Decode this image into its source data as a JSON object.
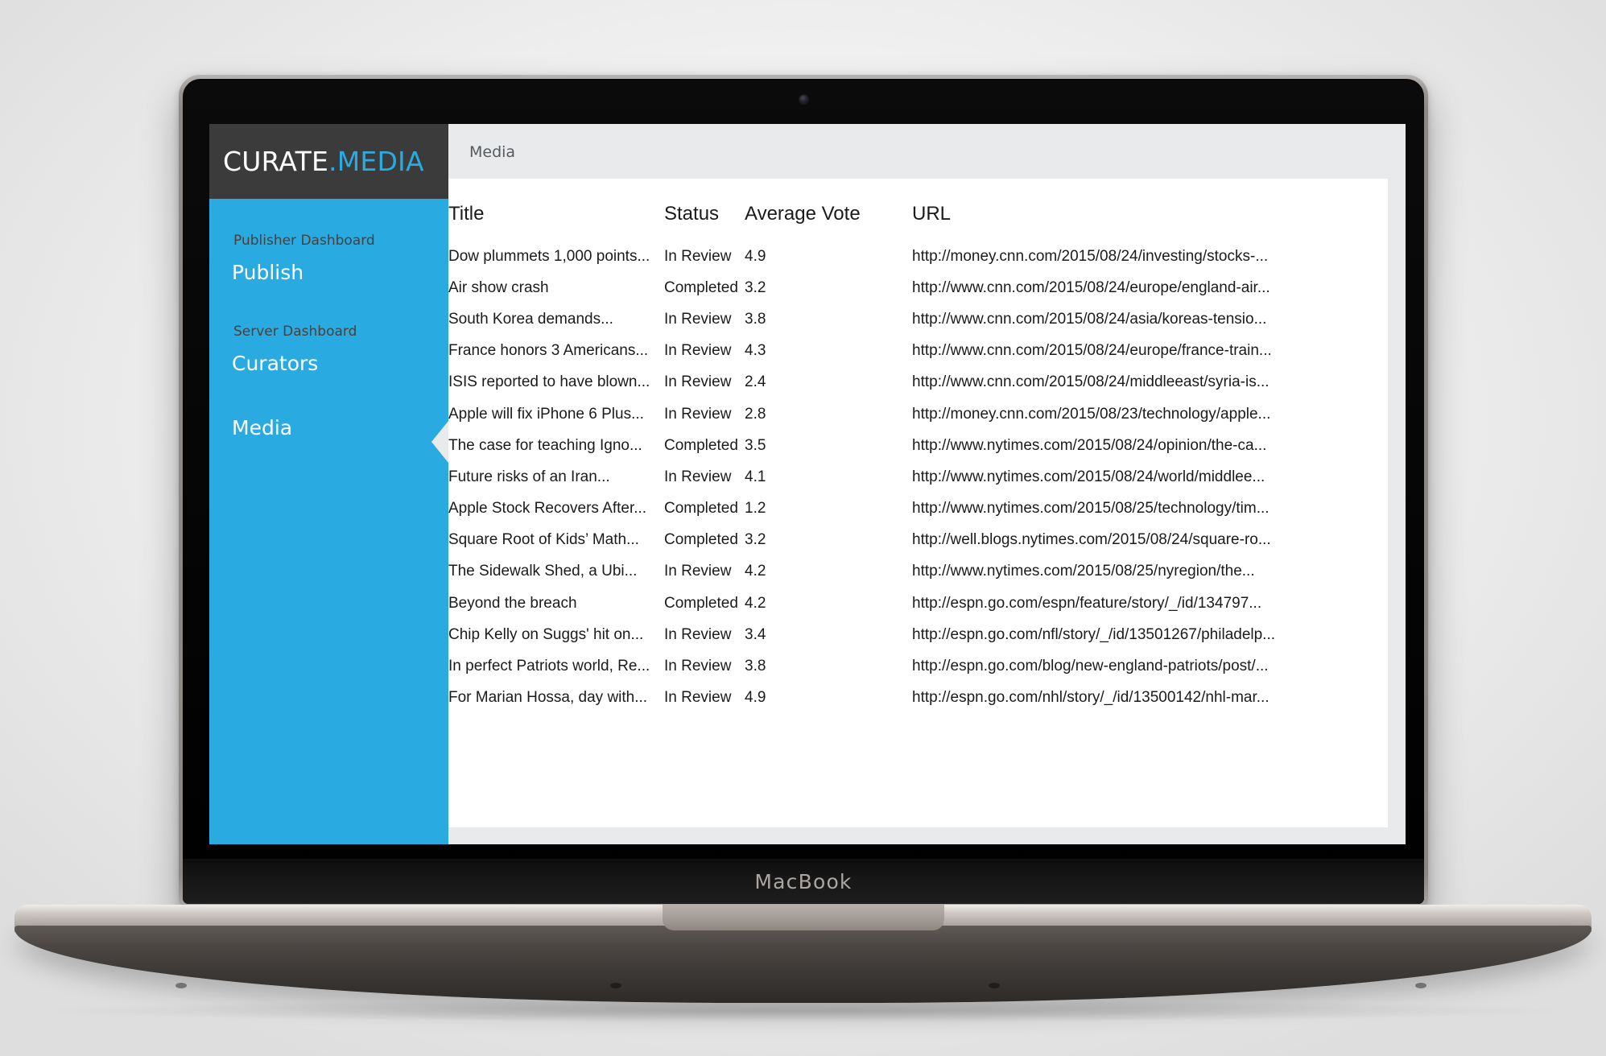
{
  "device": {
    "wordmark": "MacBook"
  },
  "brand": {
    "name": "CURATE",
    "dot": ".",
    "suffix": "MEDIA"
  },
  "sidebar": {
    "sections": [
      {
        "label": "Publisher Dashboard",
        "item": "Publish"
      },
      {
        "label": "Server Dashboard",
        "item": "Curators"
      }
    ],
    "active_item": "Media"
  },
  "content": {
    "breadcrumb": "Media"
  },
  "colors": {
    "accent": "#29ABE2",
    "brand_bar": "#3B3B3B",
    "page_bg": "#E9EAEC",
    "card_bg": "#FFFFFF",
    "text": "#1B1B1B",
    "muted_text": "#4B3F3A"
  },
  "table": {
    "columns": [
      "Title",
      "Status",
      "Average Vote",
      "URL"
    ],
    "rows": [
      {
        "title": "Dow plummets 1,000 points...",
        "status": "In Review",
        "vote": "4.9",
        "url": "http://money.cnn.com/2015/08/24/investing/stocks-..."
      },
      {
        "title": "Air show crash",
        "status": "Completed",
        "vote": "3.2",
        "url": "http://www.cnn.com/2015/08/24/europe/england-air..."
      },
      {
        "title": "South Korea demands...",
        "status": "In Review",
        "vote": "3.8",
        "url": "http://www.cnn.com/2015/08/24/asia/koreas-tensio..."
      },
      {
        "title": "France honors 3 Americans...",
        "status": "In Review",
        "vote": "4.3",
        "url": "http://www.cnn.com/2015/08/24/europe/france-train..."
      },
      {
        "title": "ISIS reported to have blown...",
        "status": "In Review",
        "vote": "2.4",
        "url": "http://www.cnn.com/2015/08/24/middleeast/syria-is..."
      },
      {
        "title": "Apple will fix iPhone 6 Plus...",
        "status": "In Review",
        "vote": "2.8",
        "url": "http://money.cnn.com/2015/08/23/technology/apple..."
      },
      {
        "title": "The case for teaching Igno...",
        "status": "Completed",
        "vote": "3.5",
        "url": "http://www.nytimes.com/2015/08/24/opinion/the-ca..."
      },
      {
        "title": "Future risks of an Iran...",
        "status": "In Review",
        "vote": "4.1",
        "url": "http://www.nytimes.com/2015/08/24/world/middlee..."
      },
      {
        "title": "Apple Stock Recovers After...",
        "status": "Completed",
        "vote": "1.2",
        "url": "http://www.nytimes.com/2015/08/25/technology/tim..."
      },
      {
        "title": "Square Root of Kids’ Math...",
        "status": "Completed",
        "vote": "3.2",
        "url": "http://well.blogs.nytimes.com/2015/08/24/square-ro..."
      },
      {
        "title": "The Sidewalk Shed, a Ubi...",
        "status": "In Review",
        "vote": "4.2",
        "url": "http://www.nytimes.com/2015/08/25/nyregion/the..."
      },
      {
        "title": "Beyond the breach",
        "status": "Completed",
        "vote": "4.2",
        "url": "http://espn.go.com/espn/feature/story/_/id/134797..."
      },
      {
        "title": "Chip Kelly on Suggs' hit on...",
        "status": "In Review",
        "vote": "3.4",
        "url": "http://espn.go.com/nfl/story/_/id/13501267/philadelp..."
      },
      {
        "title": "In perfect Patriots world, Re...",
        "status": "In Review",
        "vote": "3.8",
        "url": "http://espn.go.com/blog/new-england-patriots/post/..."
      },
      {
        "title": "For Marian Hossa, day with...",
        "status": "In Review",
        "vote": "4.9",
        "url": "http://espn.go.com/nhl/story/_/id/13500142/nhl-mar..."
      }
    ]
  }
}
